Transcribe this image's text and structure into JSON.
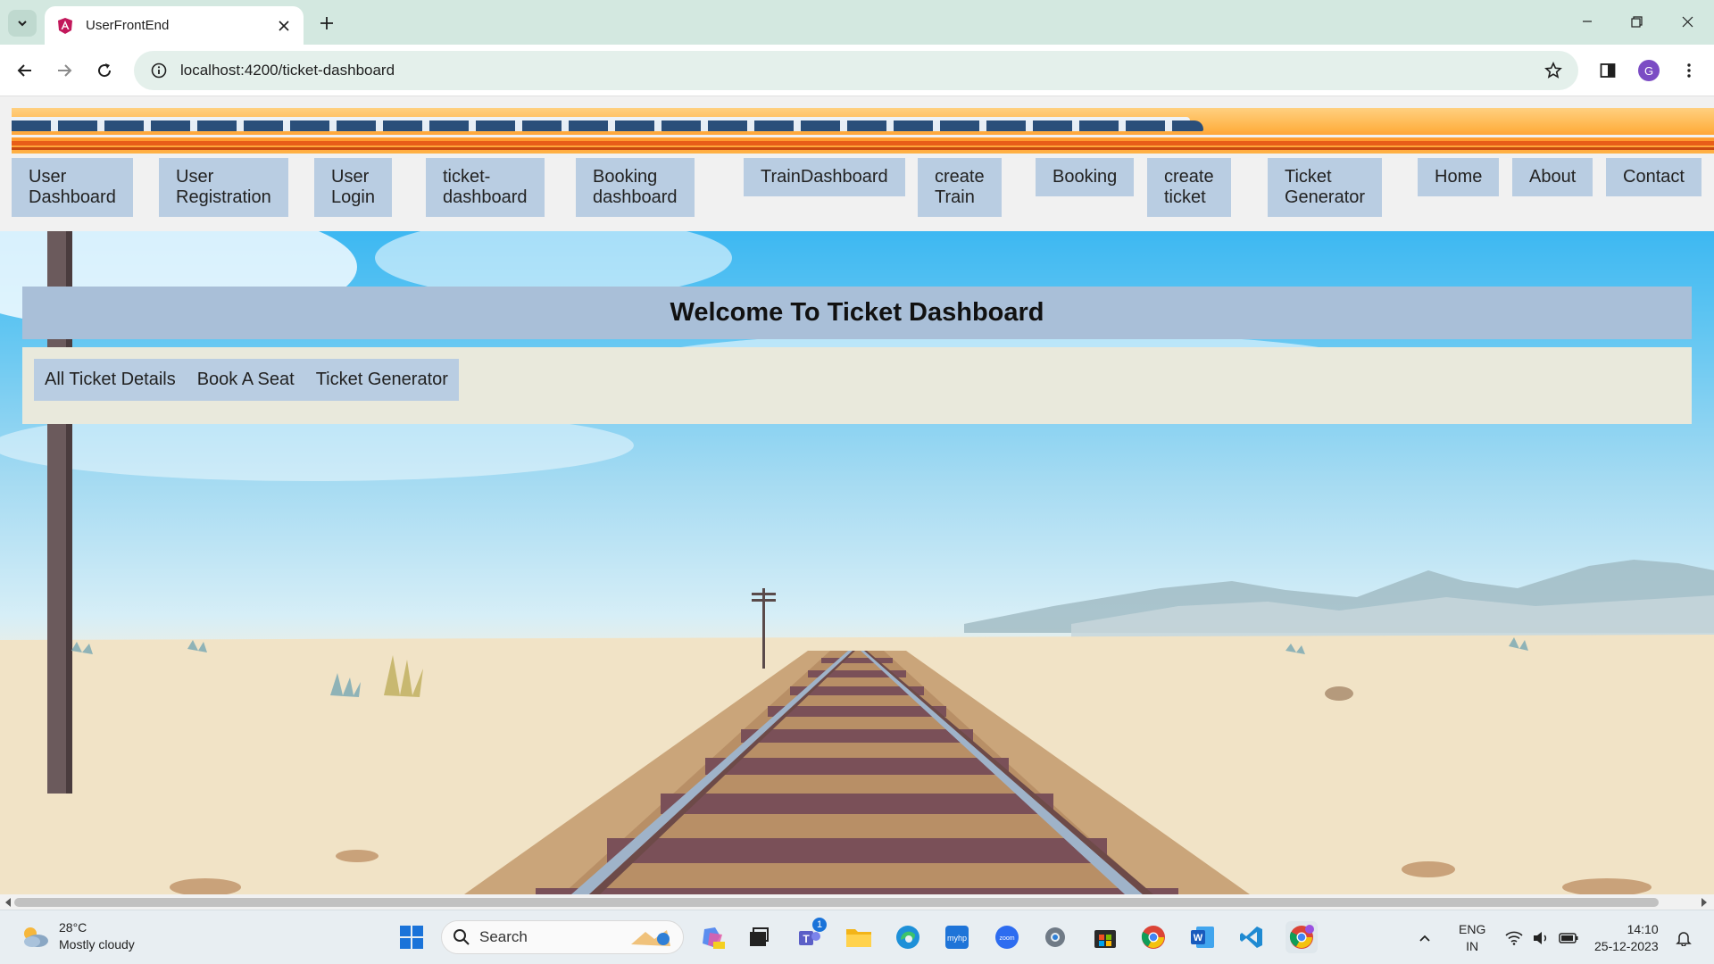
{
  "browser": {
    "tab_title": "UserFrontEnd",
    "url": "localhost:4200/ticket-dashboard",
    "profile_initial": "G"
  },
  "nav": {
    "items": [
      {
        "label": "User\nDashboard"
      },
      {
        "label": "User\nRegistration"
      },
      {
        "label": "User\nLogin"
      },
      {
        "label": "ticket-\ndashboard"
      },
      {
        "label": "Booking\ndashboard"
      },
      {
        "label": "TrainDashboard"
      },
      {
        "label": "create\nTrain"
      },
      {
        "label": "Booking"
      },
      {
        "label": "create\nticket"
      },
      {
        "label": "Ticket\nGenerator"
      },
      {
        "label": "Home"
      },
      {
        "label": "About"
      },
      {
        "label": "Contact"
      }
    ]
  },
  "main": {
    "heading": "Welcome To Ticket Dashboard",
    "subnav": [
      "All Ticket Details",
      "Book A Seat",
      "Ticket Generator"
    ]
  },
  "taskbar": {
    "temperature": "28°C",
    "weather": "Mostly cloudy",
    "search_placeholder": "Search",
    "teams_badge": "1",
    "lang_top": "ENG",
    "lang_bottom": "IN",
    "time": "14:10",
    "date": "25-12-2023"
  },
  "colors": {
    "nav_bg": "#b9cde2",
    "welcome_bg": "#a9bfd8",
    "subpanel_bg": "#e9e9dc"
  }
}
